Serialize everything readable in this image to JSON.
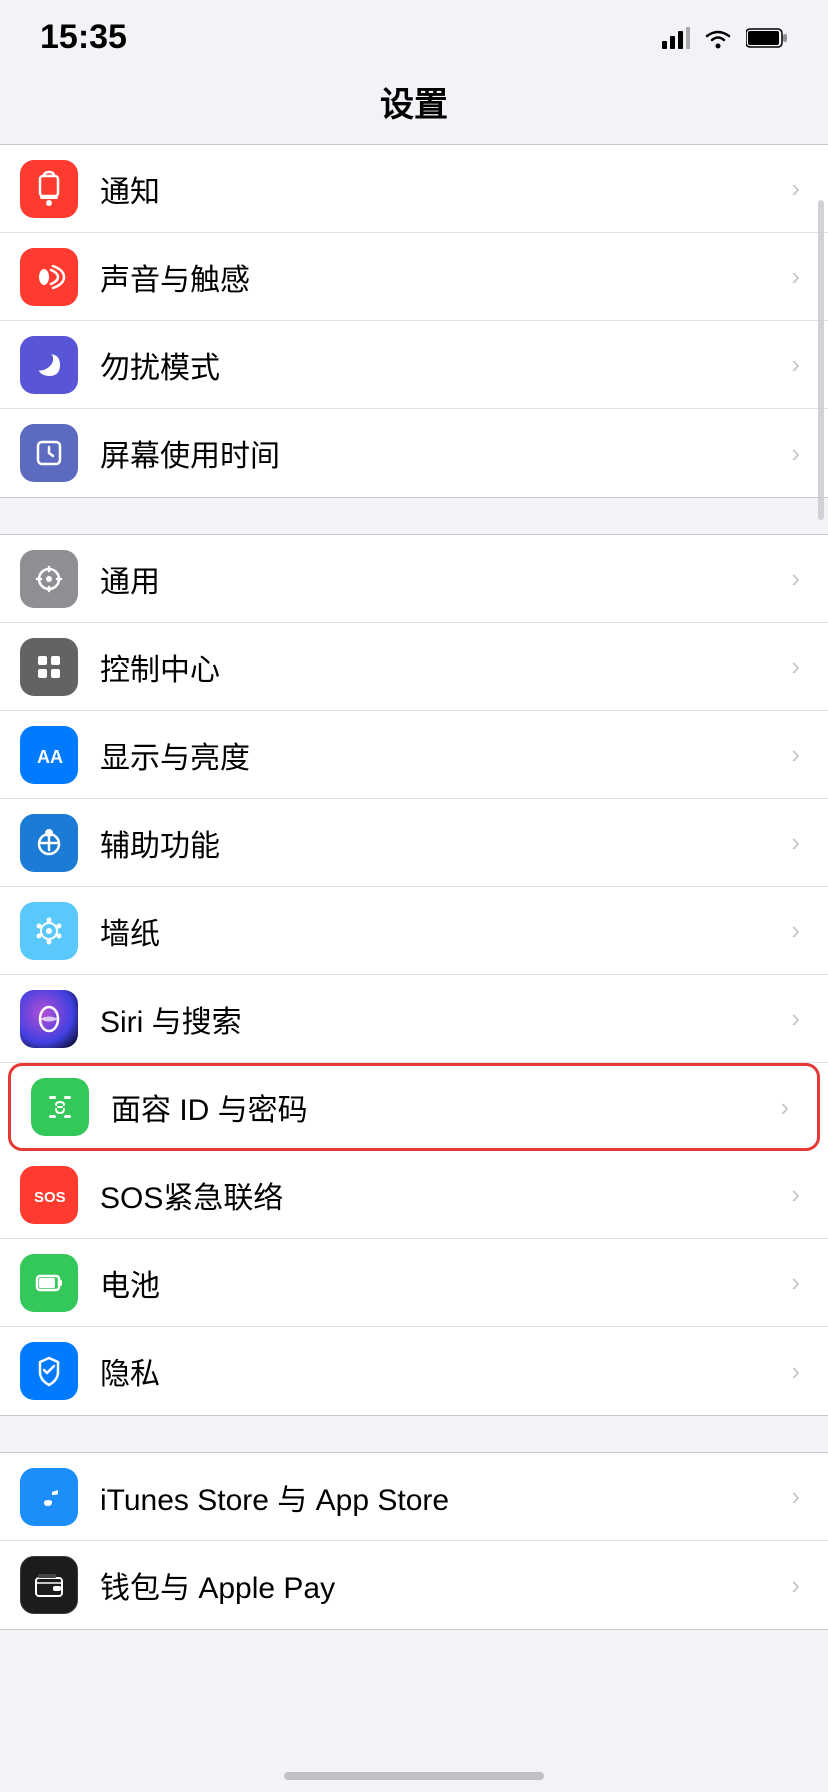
{
  "statusBar": {
    "time": "15:35",
    "signal": "signal",
    "wifi": "wifi",
    "battery": "battery"
  },
  "pageTitle": "设置",
  "groups": [
    {
      "id": "group1",
      "items": [
        {
          "id": "notifications",
          "icon": "notification",
          "iconBg": "icon-red",
          "label": "通知",
          "highlighted": false
        },
        {
          "id": "sounds",
          "icon": "sound",
          "iconBg": "icon-red2",
          "label": "声音与触感",
          "highlighted": false
        },
        {
          "id": "dnd",
          "icon": "moon",
          "iconBg": "icon-purple",
          "label": "勿扰模式",
          "highlighted": false
        },
        {
          "id": "screentime",
          "icon": "hourglass",
          "iconBg": "icon-indigo",
          "label": "屏幕使用时间",
          "highlighted": false
        }
      ]
    },
    {
      "id": "group2",
      "items": [
        {
          "id": "general",
          "icon": "gear",
          "iconBg": "icon-gray",
          "label": "通用",
          "highlighted": false
        },
        {
          "id": "controlcenter",
          "icon": "switches",
          "iconBg": "icon-gray2",
          "label": "控制中心",
          "highlighted": false
        },
        {
          "id": "display",
          "icon": "AA",
          "iconBg": "icon-blue",
          "label": "显示与亮度",
          "highlighted": false
        },
        {
          "id": "accessibility",
          "icon": "accessibility",
          "iconBg": "icon-blue2",
          "label": "辅助功能",
          "highlighted": false
        },
        {
          "id": "wallpaper",
          "icon": "flower",
          "iconBg": "icon-teal",
          "label": "墙纸",
          "highlighted": false
        },
        {
          "id": "siri",
          "icon": "siri",
          "iconBg": "icon-siri",
          "label": "Siri 与搜索",
          "highlighted": false
        },
        {
          "id": "faceid",
          "icon": "faceid",
          "iconBg": "icon-faceid",
          "label": "面容 ID 与密码",
          "highlighted": true
        },
        {
          "id": "sos",
          "icon": "sos",
          "iconBg": "icon-sos",
          "label": "SOS紧急联络",
          "highlighted": false
        },
        {
          "id": "battery",
          "icon": "battery",
          "iconBg": "icon-battery-green",
          "label": "电池",
          "highlighted": false
        },
        {
          "id": "privacy",
          "icon": "hand",
          "iconBg": "icon-privacy",
          "label": "隐私",
          "highlighted": false
        }
      ]
    },
    {
      "id": "group3",
      "items": [
        {
          "id": "itunes",
          "icon": "itunes",
          "iconBg": "icon-itunes",
          "label": "iTunes Store 与 App Store",
          "highlighted": false
        },
        {
          "id": "wallet",
          "icon": "wallet",
          "iconBg": "icon-wallet",
          "label": "钱包与 Apple Pay",
          "highlighted": false
        }
      ]
    }
  ]
}
